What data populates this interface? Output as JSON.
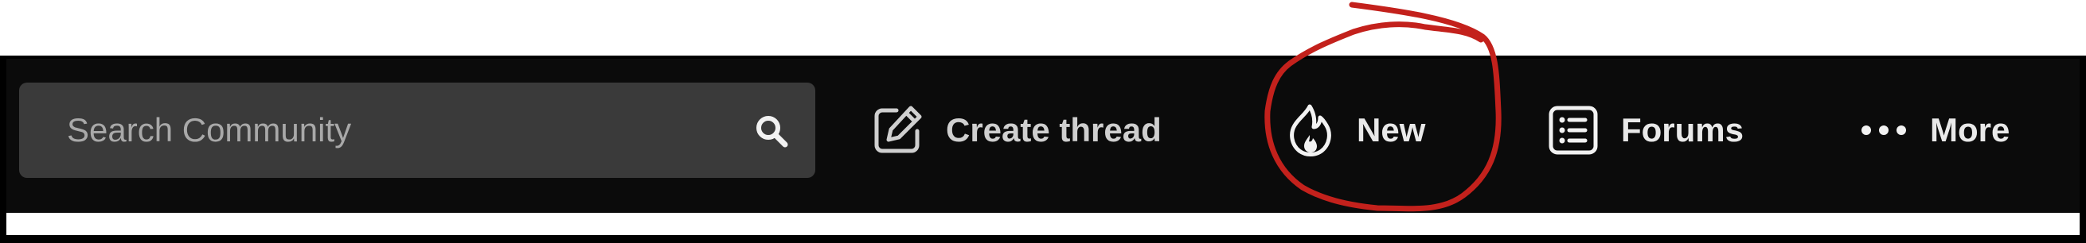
{
  "search": {
    "placeholder": "Search Community",
    "icon": "search-icon"
  },
  "nav": {
    "create_thread": {
      "label": "Create thread",
      "icon": "pencil-square-icon"
    },
    "new": {
      "label": "New",
      "icon": "flame-icon"
    },
    "forums": {
      "label": "Forums",
      "icon": "list-icon"
    },
    "more": {
      "label": "More",
      "icon": "ellipsis-icon"
    }
  },
  "colors": {
    "navbar_bg": "#0b0b0b",
    "search_bg": "#3a3a3a",
    "text": "#e9e9e9",
    "annotation": "#c3211c"
  }
}
